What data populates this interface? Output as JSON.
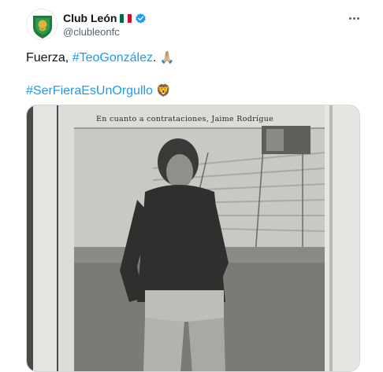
{
  "account": {
    "display_name": "Club León",
    "handle": "@clubleonfc",
    "flag_colors": [
      "#006847",
      "#ffffff",
      "#ce1126"
    ],
    "verified_color": "#1d9bf0",
    "avatar_colors": {
      "primary": "#1f7a3d",
      "accent": "#e0b23a"
    }
  },
  "tweet": {
    "text_prefix": "Fuerza, ",
    "hashtag1": "#TeoGonzález",
    "text_after_hashtag1": ". ",
    "emoji1": "🙏🏼",
    "hashtag2": "#SerFieraEsUnOrgullo",
    "emoji2": "🦁",
    "link_color": "#1d9bf0"
  },
  "media": {
    "newspaper_caption": "En cuanto a contrataciones, Jaime Rodrígue"
  },
  "icons": {
    "more": "more-horizontal-icon",
    "verified": "verified-badge-icon",
    "flag": "mexico-flag-icon"
  }
}
